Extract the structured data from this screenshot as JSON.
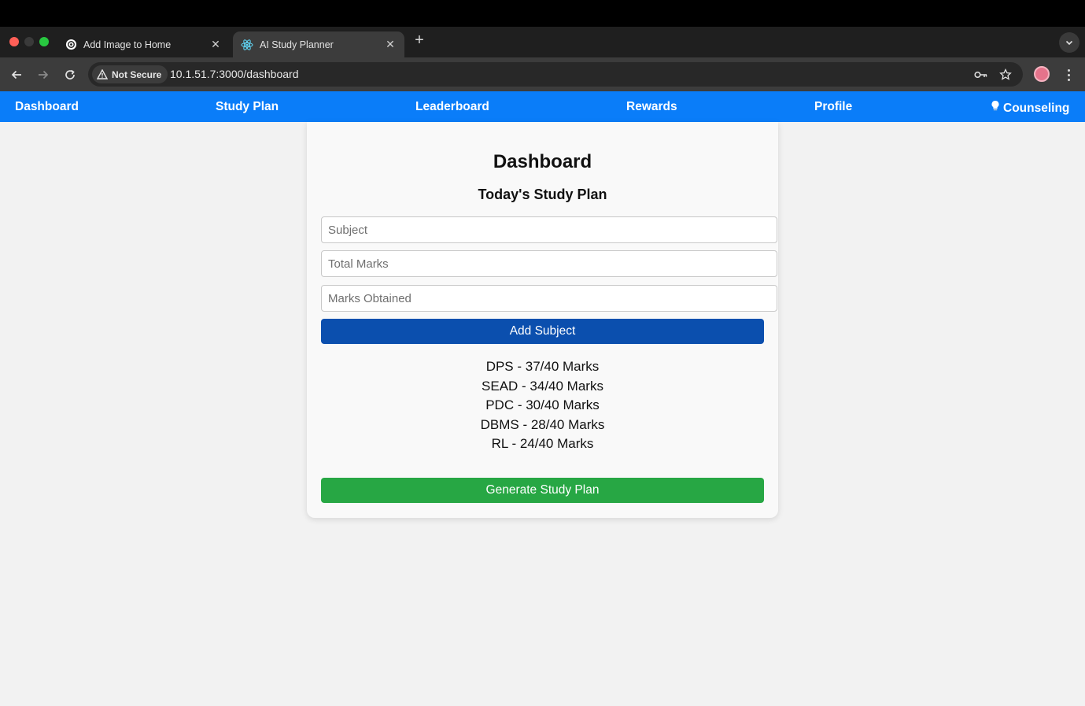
{
  "browser": {
    "tabs": [
      {
        "title": "Add Image to Home",
        "icon": "openai-icon",
        "active": false
      },
      {
        "title": "AI Study Planner",
        "icon": "react-icon",
        "active": true
      }
    ],
    "security_label": "Not Secure",
    "url": "10.1.51.7:3000/dashboard"
  },
  "nav": {
    "items": [
      "Dashboard",
      "Study Plan",
      "Leaderboard",
      "Rewards",
      "Profile",
      "Counseling"
    ],
    "bulb_glyph": "💡",
    "color": "#0a7df9"
  },
  "main": {
    "title": "Dashboard",
    "subtitle": "Today's Study Plan",
    "inputs": {
      "subject_placeholder": "Subject",
      "total_marks_placeholder": "Total Marks",
      "marks_obtained_placeholder": "Marks Obtained"
    },
    "add_button": "Add Subject",
    "subjects": [
      "DPS - 37/40 Marks",
      "SEAD - 34/40 Marks",
      "PDC - 30/40 Marks",
      "DBMS - 28/40 Marks",
      "RL - 24/40 Marks"
    ],
    "generate_button": "Generate Study Plan"
  },
  "colors": {
    "add_button": "#0b4fae",
    "generate_button": "#27a744"
  }
}
